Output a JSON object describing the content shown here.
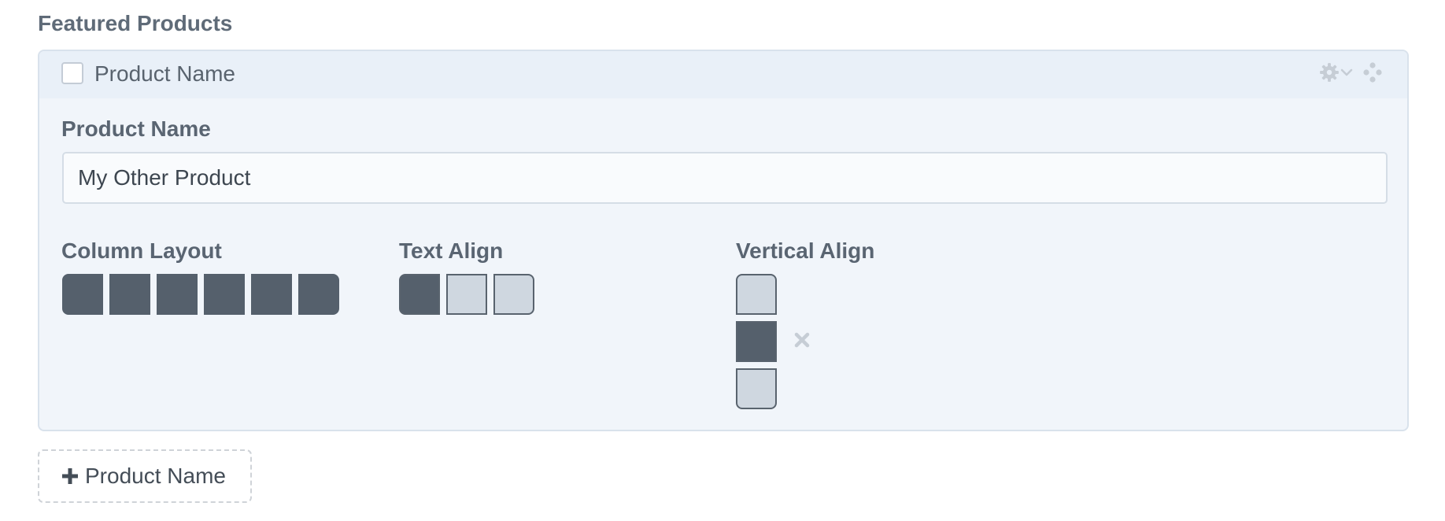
{
  "section": {
    "title": "Featured Products"
  },
  "block": {
    "header_title": "Product Name",
    "checkbox_checked": false,
    "fields": {
      "name_label": "Product Name",
      "name_value": "My Other Product",
      "column_layout_label": "Column Layout",
      "column_layout_selected": 6,
      "column_layout_total": 6,
      "text_align_label": "Text Align",
      "text_align_options": [
        "left",
        "center",
        "right"
      ],
      "text_align_selected": "left",
      "vertical_align_label": "Vertical Align",
      "vertical_align_options": [
        "top",
        "middle",
        "bottom"
      ],
      "vertical_align_selected": "middle"
    },
    "icons": {
      "settings": "gear-icon",
      "settings_dropdown": "chevron-down-icon",
      "drag": "drag-handle-icon",
      "clear": "close-icon"
    }
  },
  "add_button": {
    "label": "Product Name",
    "icon": "plus-icon"
  },
  "colors": {
    "active_swatch": "#55606c",
    "inactive_swatch": "#cfd7e0",
    "block_background": "#f1f5fa",
    "header_background": "#e9f0f8"
  }
}
